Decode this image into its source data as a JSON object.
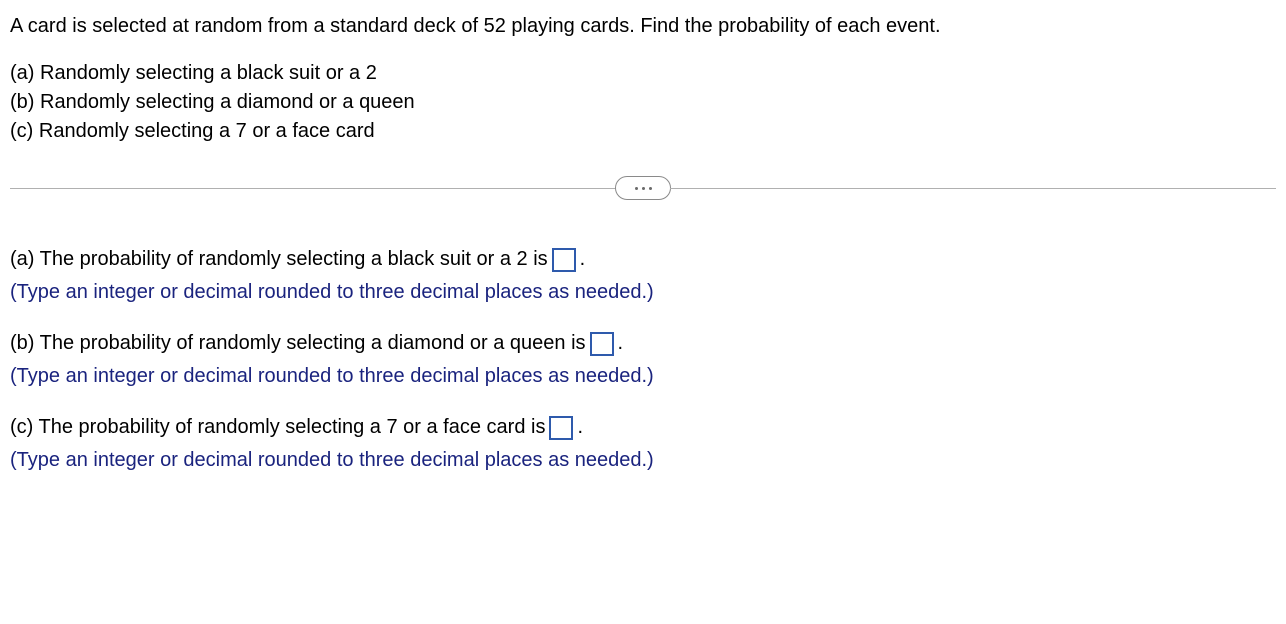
{
  "problem": {
    "statement": "A card is selected at random from a standard deck of 52 playing cards. Find the probability of each event.",
    "parts": {
      "a": "(a) Randomly selecting a black suit or a 2",
      "b": "(b) Randomly selecting a diamond or a queen",
      "c": "(c) Randomly selecting a 7 or a face card"
    }
  },
  "answers": {
    "a": {
      "prefix": "(a) The probability of randomly selecting a black suit or a 2 is ",
      "suffix": ".",
      "hint": "(Type an integer or decimal rounded to three decimal places as needed.)"
    },
    "b": {
      "prefix": "(b) The probability of randomly selecting a diamond or a queen is ",
      "suffix": ".",
      "hint": "(Type an integer or decimal rounded to three decimal places as needed.)"
    },
    "c": {
      "prefix": "(c) The probability of randomly selecting a 7 or a face card is ",
      "suffix": ".",
      "hint": "(Type an integer or decimal rounded to three decimal places as needed.)"
    }
  }
}
